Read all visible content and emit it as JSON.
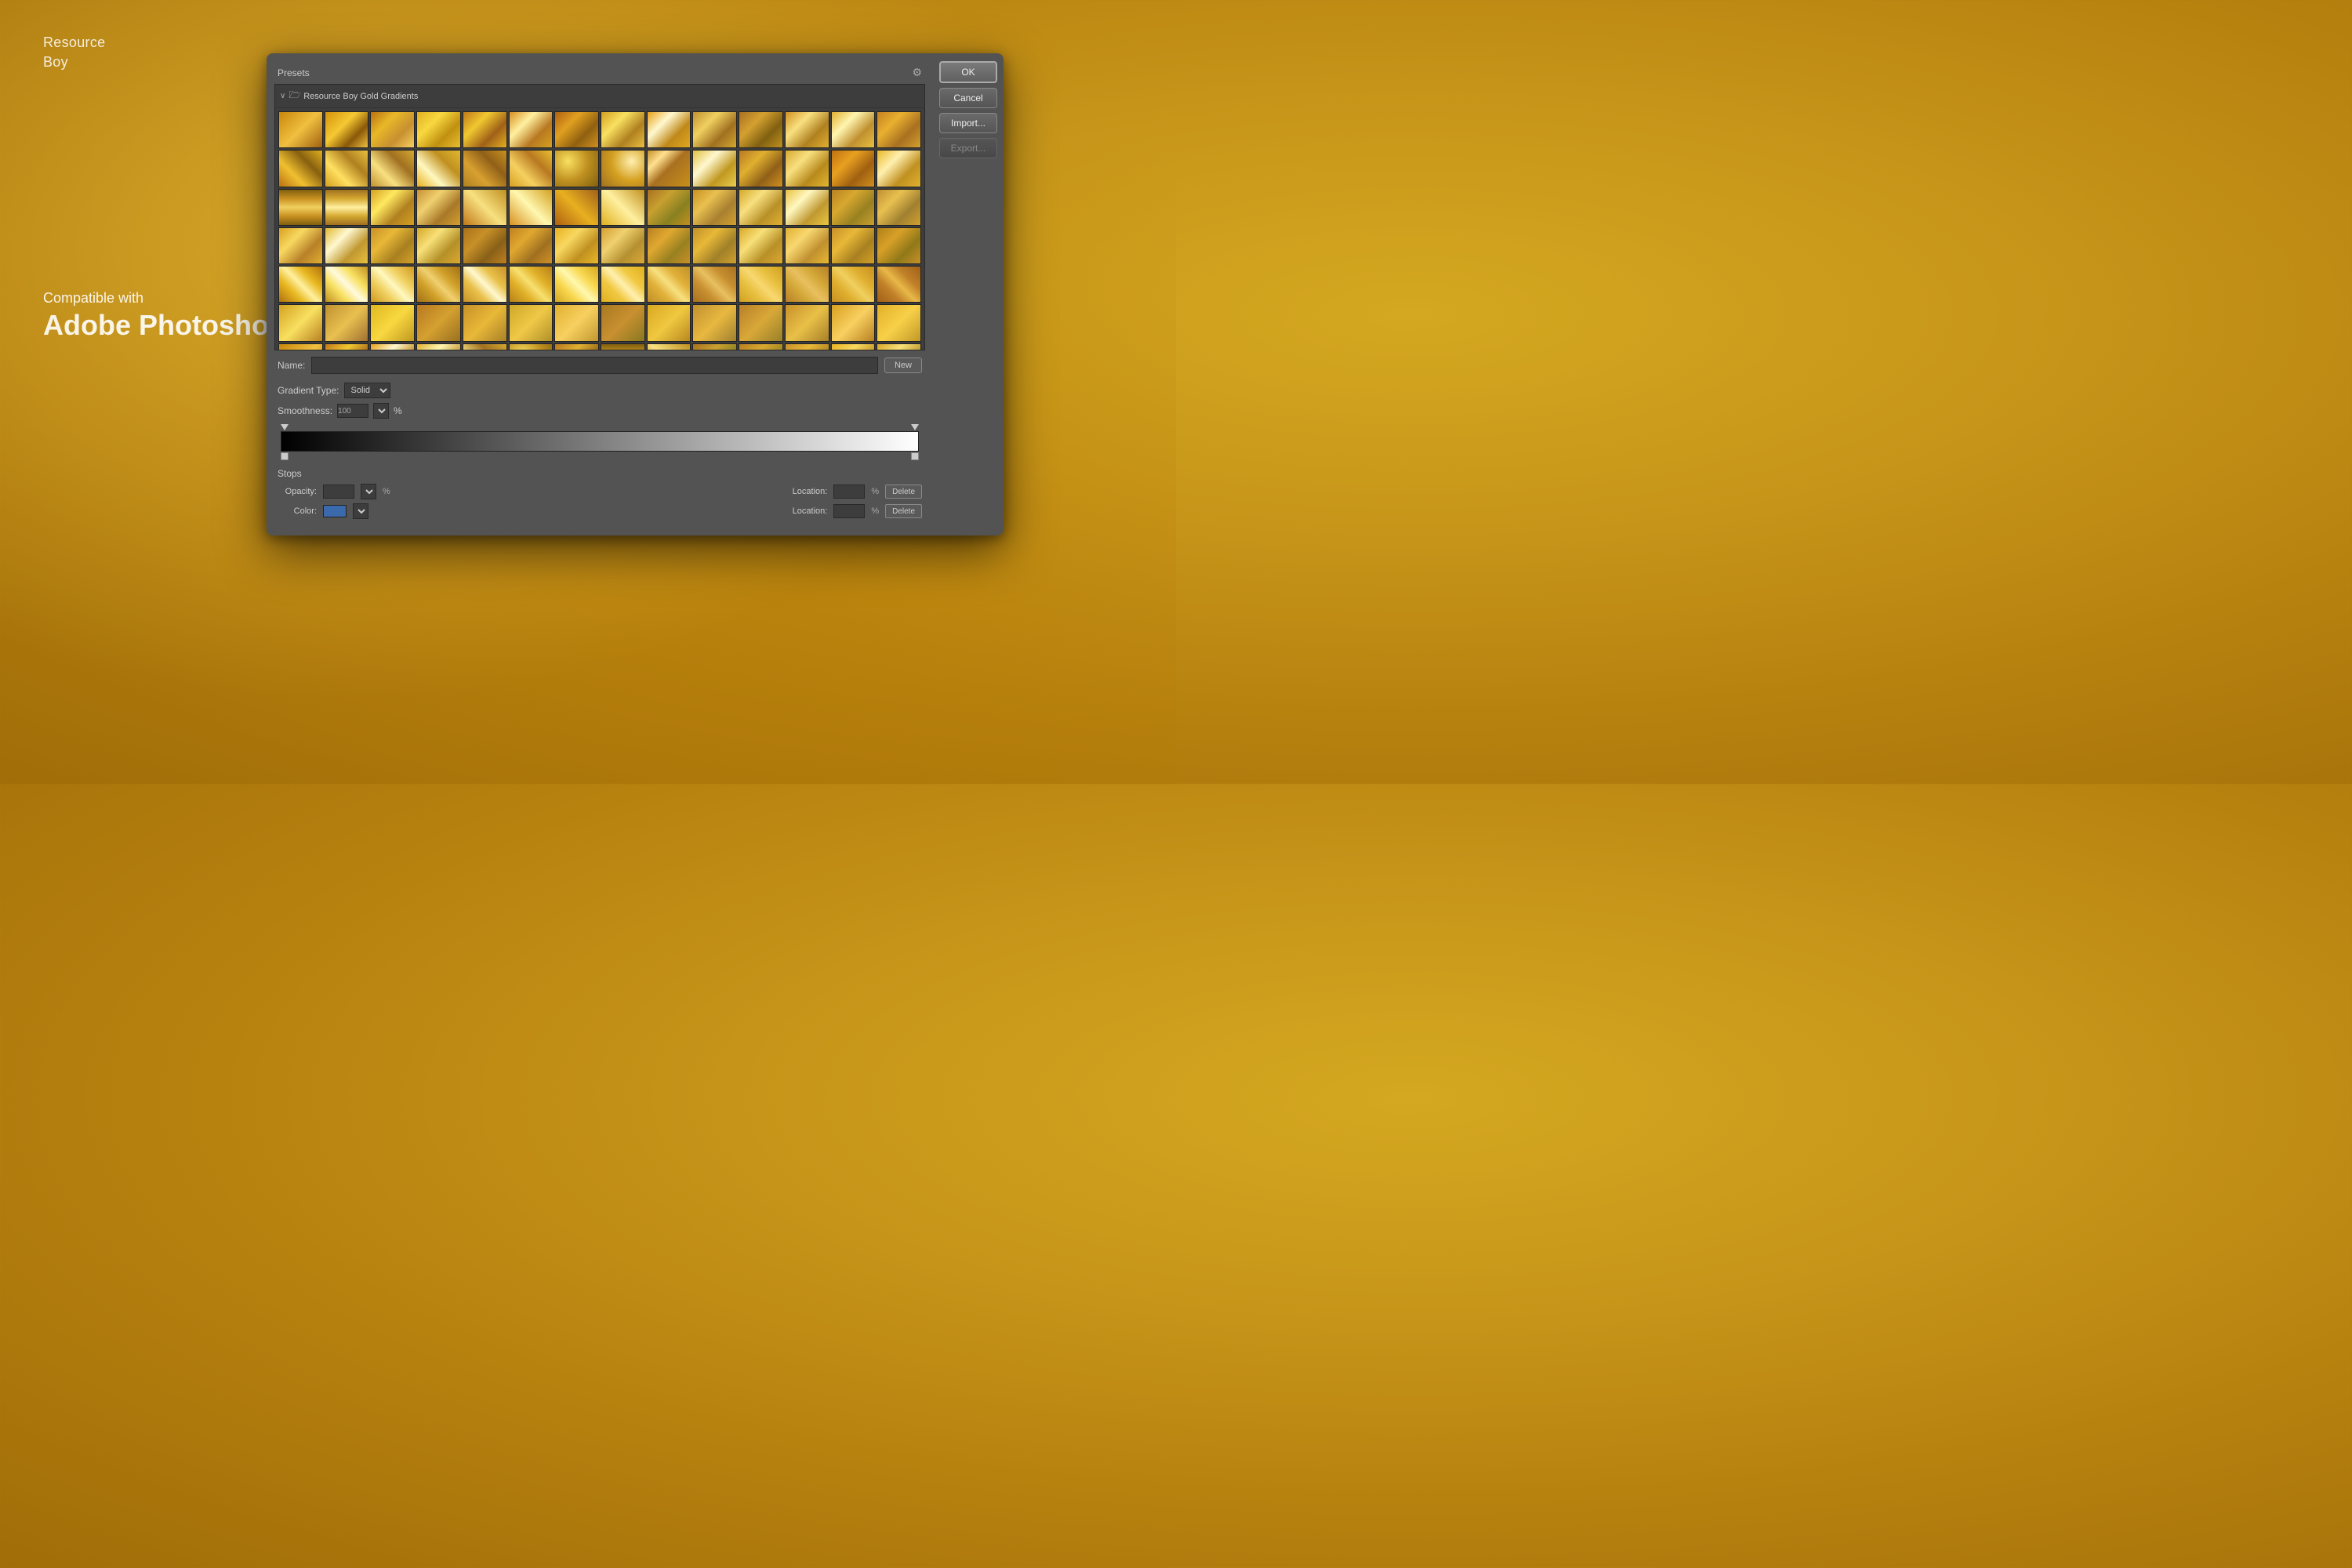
{
  "brand": {
    "name_line1": "Resource",
    "name_line2": "Boy"
  },
  "compatible": {
    "subtitle": "Compatible with",
    "title": "Adobe Photoshop"
  },
  "dialog": {
    "presets_label": "Presets",
    "gear_icon": "⚙",
    "folder_chevron": "∨",
    "folder_icon": "📁",
    "folder_name": "Resource Boy Gold Gradients",
    "ok_button": "OK",
    "cancel_button": "Cancel",
    "import_button": "Import...",
    "export_button": "Export...",
    "name_label": "Name:",
    "new_button": "New",
    "gradient_type_label": "Gradient Type:",
    "gradient_type_value": "Solid",
    "smoothness_label": "Smoothness:",
    "smoothness_value": "100",
    "smoothness_pct": "%",
    "stops_title": "Stops",
    "opacity_label": "Opacity:",
    "opacity_pct": "%",
    "location_label": "Location:",
    "location_pct": "%",
    "delete_label": "Delete",
    "color_label": "Color:",
    "location2_label": "Location:",
    "location2_pct": "%",
    "delete2_label": "Delete"
  }
}
